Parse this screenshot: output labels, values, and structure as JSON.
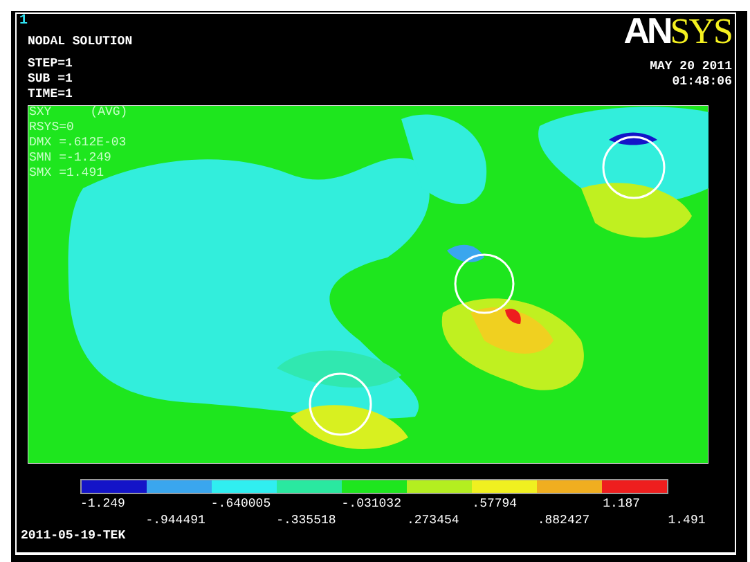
{
  "window_number": "1",
  "title": "NODAL SOLUTION",
  "step_info": [
    "STEP=1",
    "SUB =1",
    "TIME=1"
  ],
  "logo": {
    "part_1": "AN",
    "part_2": "SYS"
  },
  "date": "MAY 20 2011",
  "time": "01:48:06",
  "plot_info": [
    [
      "SXY",
      "(AVG)"
    ],
    [
      "RSYS=0"
    ],
    [
      "DMX =.612E-03"
    ],
    [
      "SMN =-1.249"
    ],
    [
      "SMX =1.491"
    ]
  ],
  "legend": {
    "bands": [
      {
        "color": "#1414c8"
      },
      {
        "color": "#3aa6ee"
      },
      {
        "color": "#30eef0"
      },
      {
        "color": "#2ae8a0"
      },
      {
        "color": "#1ee61e"
      },
      {
        "color": "#b4ee20"
      },
      {
        "color": "#f0f020"
      },
      {
        "color": "#f0ae20"
      },
      {
        "color": "#ee1e1e"
      }
    ],
    "values": [
      "-1.249",
      "-.944491",
      "-.640005",
      "-.335518",
      "-.031032",
      ".273454",
      ".57794",
      ".882427",
      "1.187",
      "1.491"
    ]
  },
  "footer": "2011-05-19-TEK"
}
